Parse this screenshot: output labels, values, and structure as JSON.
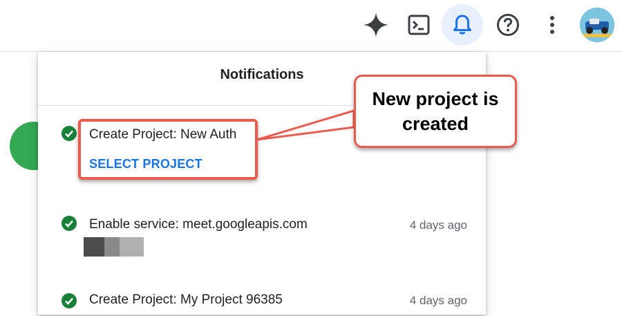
{
  "panel": {
    "title": "Notifications"
  },
  "notifications": [
    {
      "title": "Create Project: New Auth",
      "action": "SELECT PROJECT",
      "time": ""
    },
    {
      "title": "Enable service: meet.googleapis.com",
      "time": "4 days ago"
    },
    {
      "title": "Create Project: My Project 96385",
      "time": "4 days ago"
    }
  ],
  "annotation": {
    "callout": "New project is created"
  },
  "colors": {
    "accent": "#1a73e8",
    "success": "#188038",
    "annotation": "#ec5a4d",
    "active_bg": "#e8f0fe"
  },
  "icons": {
    "topbar": [
      "gemini-sparkle-icon",
      "cloud-shell-icon",
      "bell-icon",
      "help-icon",
      "more-vert-icon",
      "avatar"
    ],
    "status": "check-circle-icon"
  }
}
